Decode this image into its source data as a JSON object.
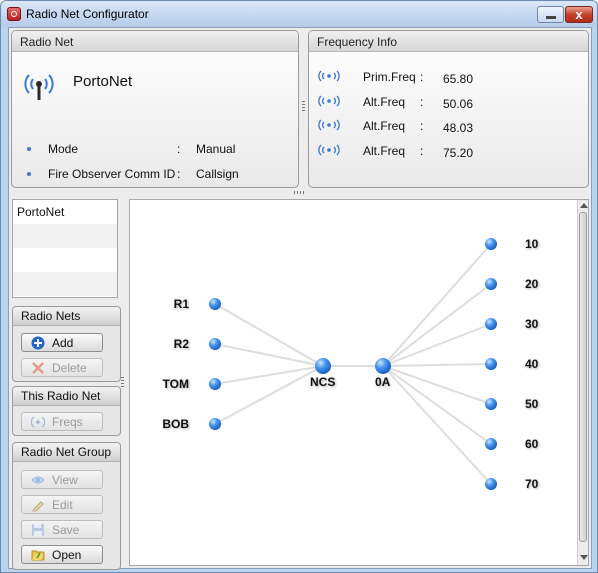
{
  "window": {
    "title": "Radio Net Configurator",
    "close_glyph": "x"
  },
  "radio_net": {
    "header": "Radio Net",
    "name": "PortoNet",
    "props": [
      {
        "label": "Mode",
        "colon": ":",
        "value": "Manual"
      },
      {
        "label": "Fire Observer Comm ID",
        "colon": ":",
        "value": "Callsign"
      }
    ]
  },
  "frequency_info": {
    "header": "Frequency Info",
    "rows": [
      {
        "label": "Prim.Freq",
        "colon": ":",
        "value": "65.80"
      },
      {
        "label": "Alt.Freq",
        "colon": ":",
        "value": "50.06"
      },
      {
        "label": "Alt.Freq",
        "colon": ":",
        "value": "48.03"
      },
      {
        "label": "Alt.Freq",
        "colon": ":",
        "value": "75.20"
      }
    ]
  },
  "net_list": {
    "items": [
      "PortoNet"
    ]
  },
  "radio_nets_group": {
    "header": "Radio Nets",
    "add_label": "Add",
    "delete_label": "Delete"
  },
  "this_radio_net_group": {
    "header": "This Radio Net",
    "freqs_label": "Freqs"
  },
  "radio_net_group": {
    "header": "Radio Net Group",
    "view_label": "View",
    "edit_label": "Edit",
    "save_label": "Save",
    "open_label": "Open"
  },
  "diagram": {
    "left_nodes": [
      "R1",
      "R2",
      "TOM",
      "BOB"
    ],
    "center_nodes": [
      "NCS",
      "0A"
    ],
    "right_nodes": [
      "10",
      "20",
      "30",
      "40",
      "50",
      "60",
      "70"
    ]
  },
  "colors": {
    "accent": "#3b7ad1",
    "node": "#2f7fe0",
    "edge": "#dddddd"
  },
  "icons": {
    "app": "app-icon",
    "radio_net": "radio-tower-icon",
    "frequency": "wave-icon",
    "add": "plus-circle-icon",
    "delete": "red-x-icon",
    "freqs": "wave-icon",
    "view": "eye-icon",
    "edit": "pencil-icon",
    "save": "floppy-disk-icon",
    "open": "folder-icon"
  }
}
